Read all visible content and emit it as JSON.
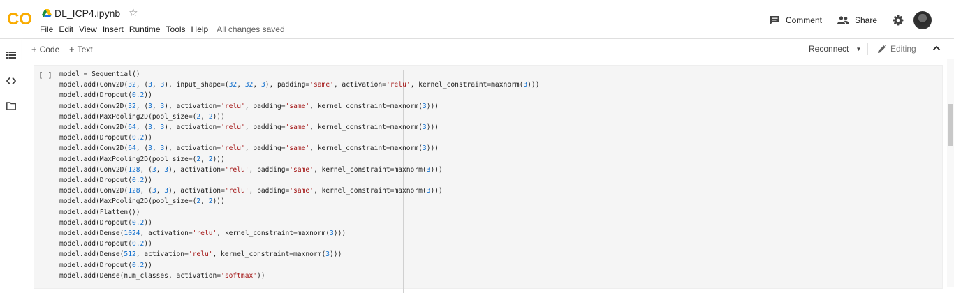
{
  "app": {
    "logo": "CO",
    "brand_color": "#f9ab00",
    "notebook_title": "DL_ICP4.ipynb",
    "save_status": "All changes saved"
  },
  "menu": [
    "File",
    "Edit",
    "View",
    "Insert",
    "Runtime",
    "Tools",
    "Help"
  ],
  "header_actions": {
    "comment": "Comment",
    "share": "Share"
  },
  "toolbar": {
    "add_code": "Code",
    "add_text": "Text",
    "reconnect": "Reconnect",
    "mode": "Editing"
  },
  "sidebar": {
    "icons": [
      "table-of-contents-icon",
      "code-snippets-icon",
      "files-icon"
    ]
  },
  "cell": {
    "run_indicator": "[ ]",
    "lines": [
      "model = Sequential()",
      "model.add(Conv2D(32, (3, 3), input_shape=(32, 32, 3), padding='same', activation='relu', kernel_constraint=maxnorm(3)))",
      "model.add(Dropout(0.2))",
      "model.add(Conv2D(32, (3, 3), activation='relu', padding='same', kernel_constraint=maxnorm(3)))",
      "model.add(MaxPooling2D(pool_size=(2, 2)))",
      "model.add(Conv2D(64, (3, 3), activation='relu', padding='same', kernel_constraint=maxnorm(3)))",
      "model.add(Dropout(0.2))",
      "model.add(Conv2D(64, (3, 3), activation='relu', padding='same', kernel_constraint=maxnorm(3)))",
      "model.add(MaxPooling2D(pool_size=(2, 2)))",
      "model.add(Conv2D(128, (3, 3), activation='relu', padding='same', kernel_constraint=maxnorm(3)))",
      "model.add(Dropout(0.2))",
      "model.add(Conv2D(128, (3, 3), activation='relu', padding='same', kernel_constraint=maxnorm(3)))",
      "model.add(MaxPooling2D(pool_size=(2, 2)))",
      "model.add(Flatten())",
      "model.add(Dropout(0.2))",
      "model.add(Dense(1024, activation='relu', kernel_constraint=maxnorm(3)))",
      "model.add(Dropout(0.2))",
      "model.add(Dense(512, activation='relu', kernel_constraint=maxnorm(3)))",
      "model.add(Dropout(0.2))",
      "model.add(Dense(num_classes, activation='softmax'))"
    ]
  },
  "colors": {
    "string": "#a31515",
    "number": "#0b6bcb",
    "cell_background": "#f5f5f5"
  }
}
